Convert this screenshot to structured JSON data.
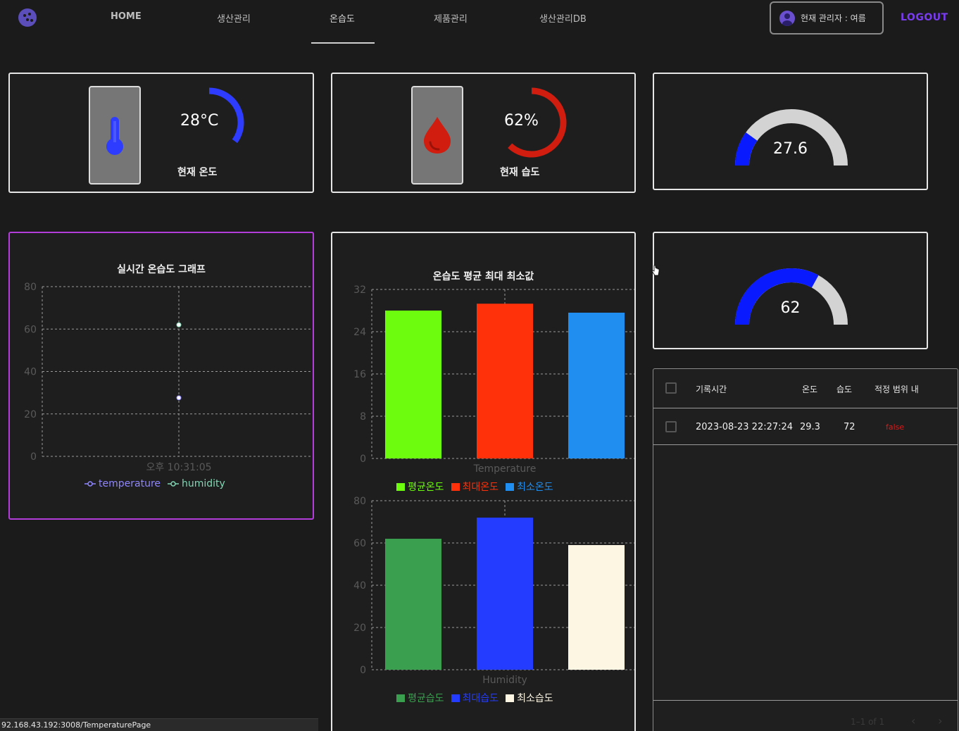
{
  "nav": {
    "home": "HOME",
    "production": "생산관리",
    "temp_humidity": "온습도",
    "product": "제품관리",
    "production_db": "생산관리DB",
    "admin_label": "현재 관리자 : 여름",
    "logout": "LOGOUT"
  },
  "temp_card": {
    "value": "28°C",
    "label": "현재 온도",
    "level": 0.35,
    "color": "#2d3cff",
    "icon": "thermometer-icon"
  },
  "humid_card": {
    "value": "62%",
    "label": "현재 습도",
    "level": 0.62,
    "color": "#d01d10",
    "icon": "water-drop-icon"
  },
  "gauge_temp": {
    "value": "27.6",
    "fraction": 0.2,
    "fill": "#0a1aff",
    "track": "#d3d3d3"
  },
  "gauge_humid": {
    "value": "62",
    "fraction": 0.66,
    "fill": "#0a1aff",
    "track": "#d3d3d3"
  },
  "chart_data": [
    {
      "type": "line",
      "title": "실시간 온습도 그래프",
      "x": [
        "오후 10:31:05"
      ],
      "series": [
        {
          "name": "temperature",
          "values": [
            27.6
          ],
          "color": "#8f86ff"
        },
        {
          "name": "humidity",
          "values": [
            62
          ],
          "color": "#82d5b4"
        }
      ],
      "ylim": [
        0,
        80
      ],
      "yticks": [
        0,
        20,
        40,
        60,
        80
      ],
      "grid": true,
      "legend": "bottom"
    },
    {
      "type": "bar",
      "title": "온습도 평균 최대 최소값",
      "xlabel": "Temperature",
      "categories": [
        "평균온도",
        "최대온도",
        "최소온도"
      ],
      "values": [
        28,
        29.3,
        27.6
      ],
      "colors": [
        "#6dfb0e",
        "#ff310a",
        "#1f8ef0"
      ],
      "ylim": [
        0,
        32
      ],
      "yticks": [
        0,
        8,
        16,
        24,
        32
      ],
      "grid": true,
      "legend": "bottom"
    },
    {
      "type": "bar",
      "xlabel": "Humidity",
      "categories": [
        "평균습도",
        "최대습도",
        "최소습도"
      ],
      "values": [
        62,
        72,
        59
      ],
      "colors": [
        "#3aa050",
        "#243cff",
        "#fdf6e3"
      ],
      "ylim": [
        0,
        80
      ],
      "yticks": [
        0,
        20,
        40,
        60,
        80
      ],
      "grid": true,
      "legend": "bottom"
    }
  ],
  "table": {
    "columns": [
      "기록시간",
      "온도",
      "습도",
      "적정 범위 내"
    ],
    "rows": [
      {
        "time": "2023-08-23 22:27:24",
        "temp": "29.3",
        "humid": "72",
        "in_range": "false"
      }
    ],
    "pagination": "1–1 of 1",
    "prev": "‹",
    "next": "›",
    "status_color": "#d81a1a"
  },
  "status_bar": "92.168.43.192:3008/TemperaturePage"
}
